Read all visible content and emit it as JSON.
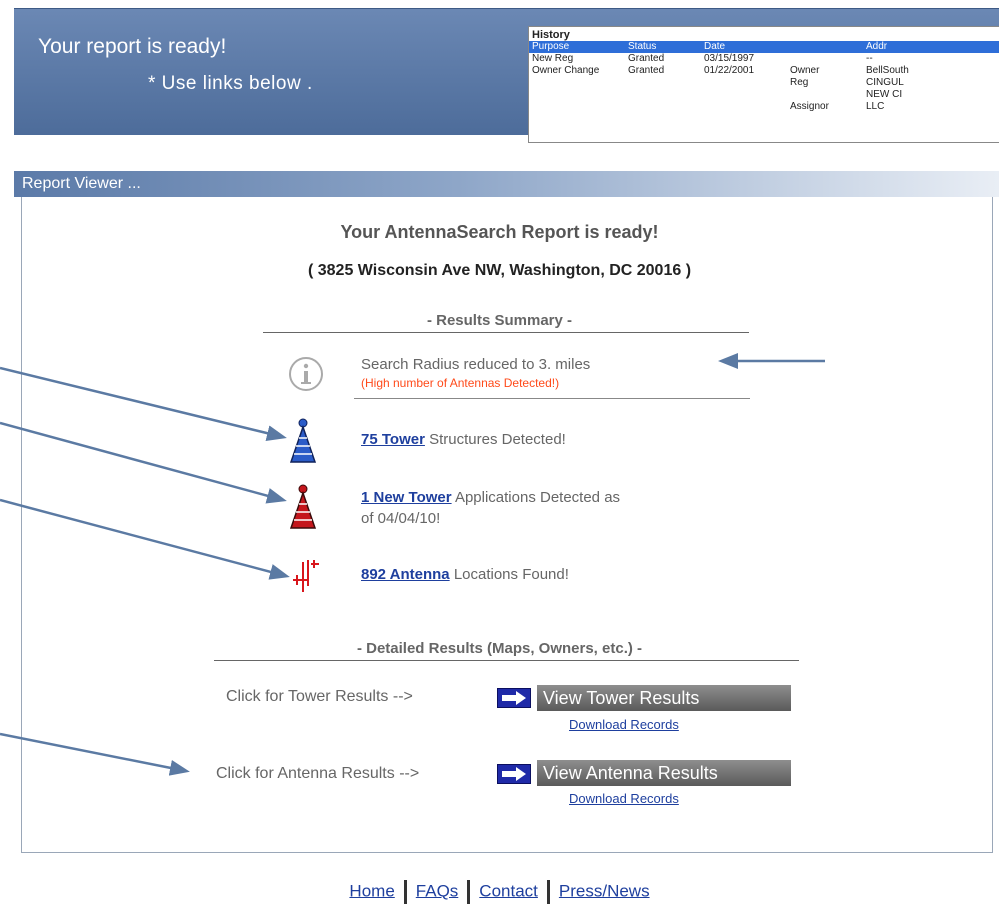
{
  "banner": {
    "ready_text": "Your report is ready!",
    "use_links_text": "* Use links below ."
  },
  "history": {
    "title": "History",
    "headers": [
      "Purpose",
      "Status",
      "Date",
      "",
      "Addr"
    ],
    "rows": [
      [
        "New Reg",
        "Granted",
        "03/15/1997",
        "",
        "--"
      ],
      [
        "Owner Change",
        "Granted",
        "01/22/2001",
        "Owner",
        "BellSouth"
      ],
      [
        "",
        "",
        "",
        "Reg",
        "CINGUL"
      ],
      [
        "",
        "",
        "",
        "",
        "NEW CI"
      ],
      [
        "",
        "",
        "",
        "Assignor",
        "LLC"
      ]
    ]
  },
  "report_viewer": {
    "bar_title": "Report Viewer ...",
    "heading": "Your AntennaSearch Report is ready!",
    "address": "( 3825 Wisconsin Ave NW, Washington, DC 20016 )",
    "results_summary_title": "- Results Summary -",
    "search_radius_text": "Search Radius reduced to 3. miles",
    "warning_text": "(High number of Antennas Detected!)",
    "tower_link": "75 Tower",
    "tower_text": "Structures Detected!",
    "new_tower_link": "1 New Tower",
    "new_tower_text_1": "Applications Detected as",
    "new_tower_text_2": "of 04/04/10!",
    "antenna_link": "892 Antenna",
    "antenna_text": "Locations Found!",
    "detailed_title": "- Detailed Results (Maps, Owners, etc.) -",
    "tower_click_text": "Click for Tower Results -->",
    "tower_button": "View Tower Results",
    "antenna_click_text": "Click for Antenna Results -->",
    "antenna_button": "View Antenna Results",
    "download_label": "Download Records"
  },
  "footer": {
    "links": [
      "Home",
      "FAQs",
      "Contact",
      "Press/News"
    ]
  },
  "icons": {
    "info": "info-icon",
    "blue_tower": "blue-tower-icon",
    "red_tower": "red-tower-icon",
    "antenna": "antenna-icon",
    "arrow": "arrow-right-icon"
  },
  "colors": {
    "banner_blue": "#5a78a6",
    "link_blue": "#1e3f9e",
    "warning_orange": "#ff4a1a",
    "tower_blue": "#2b5cc8",
    "tower_red": "#c4161c",
    "annotation_arrow": "#5b7aa3"
  }
}
